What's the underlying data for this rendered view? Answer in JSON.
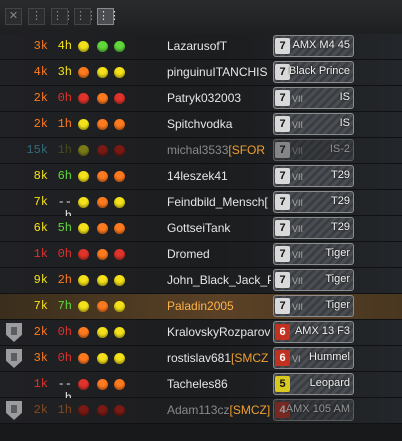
{
  "toolbar": {
    "buttons": [
      {
        "icon": "close-icon",
        "glyph": "✕"
      },
      {
        "icon": "column-toggle-1-icon",
        "glyph": "⋮"
      },
      {
        "icon": "column-toggle-2-icon",
        "glyph": "⋮⋮"
      },
      {
        "icon": "column-toggle-3-icon",
        "glyph": "⋮⋮"
      },
      {
        "icon": "column-toggle-4-icon",
        "glyph": "⋮⋮"
      }
    ]
  },
  "colors": {
    "red": "#e0332b",
    "orange": "#ff7a1f",
    "yellow": "#f4e11a",
    "green": "#60d83a",
    "cyan": "#4cc3e0",
    "white": "#e8e8e8",
    "darkred": "#7a1a14",
    "olive": "#7a7a1a",
    "grey": "#6a6a6a"
  },
  "players": [
    {
      "wins": "3k",
      "wc": "orange",
      "time": "4h",
      "tc": "yellow",
      "d": [
        "yellow",
        "green",
        "green"
      ],
      "name": "LazarusofT",
      "clan": "",
      "tier": "7",
      "tc2": "white",
      "roman": "",
      "tank": "AMX M4 45",
      "badge": false,
      "self": false,
      "dead": false
    },
    {
      "wins": "4k",
      "wc": "orange",
      "time": "3h",
      "tc": "yellow",
      "d": [
        "orange",
        "yellow",
        "yellow"
      ],
      "name": "pinguinuITANCHIS",
      "clan": "",
      "tier": "7",
      "tc2": "white",
      "roman": "",
      "tank": "Black Prince",
      "badge": false,
      "self": false,
      "dead": false
    },
    {
      "wins": "2k",
      "wc": "orange",
      "time": "0h",
      "tc": "red",
      "d": [
        "red",
        "orange",
        "red"
      ],
      "name": "Patryk032003",
      "clan": "",
      "tier": "7",
      "tc2": "white",
      "roman": "VII",
      "tank": "IS",
      "badge": false,
      "self": false,
      "dead": false
    },
    {
      "wins": "2k",
      "wc": "orange",
      "time": "1h",
      "tc": "orange",
      "d": [
        "yellow",
        "orange",
        "orange"
      ],
      "name": "Spitchvodka",
      "clan": "",
      "tier": "7",
      "tc2": "white",
      "roman": "VII",
      "tank": "IS",
      "badge": false,
      "self": false,
      "dead": false
    },
    {
      "wins": "15k",
      "wc": "cyan",
      "time": "1h",
      "tc": "olive",
      "d": [
        "olive",
        "darkred",
        "darkred"
      ],
      "name": "michal3533",
      "clan": "[SFOR",
      "tier": "7",
      "tc2": "white",
      "roman": "VII",
      "tank": "IS-2",
      "badge": false,
      "self": false,
      "dead": true
    },
    {
      "wins": "8k",
      "wc": "yellow",
      "time": "6h",
      "tc": "green",
      "d": [
        "yellow",
        "orange",
        "orange"
      ],
      "name": "14leszek41",
      "clan": "",
      "tier": "7",
      "tc2": "white",
      "roman": "VII",
      "tank": "T29",
      "badge": false,
      "self": false,
      "dead": false
    },
    {
      "wins": "7k",
      "wc": "yellow",
      "time": "--h",
      "tc": "white",
      "d": [
        "yellow",
        "orange",
        "yellow"
      ],
      "name": "Feindbild_Mensch[",
      "clan": "",
      "tier": "7",
      "tc2": "white",
      "roman": "VII",
      "tank": "T29",
      "badge": false,
      "self": false,
      "dead": false
    },
    {
      "wins": "6k",
      "wc": "yellow",
      "time": "5h",
      "tc": "green",
      "d": [
        "yellow",
        "orange",
        "orange"
      ],
      "name": "GottseiTank",
      "clan": "",
      "tier": "7",
      "tc2": "white",
      "roman": "VII",
      "tank": "T29",
      "badge": false,
      "self": false,
      "dead": false
    },
    {
      "wins": "1k",
      "wc": "red",
      "time": "0h",
      "tc": "red",
      "d": [
        "red",
        "orange",
        "red"
      ],
      "name": "Dromed",
      "clan": "",
      "tier": "7",
      "tc2": "white",
      "roman": "VII",
      "tank": "Tiger",
      "badge": false,
      "self": false,
      "dead": false
    },
    {
      "wins": "9k",
      "wc": "yellow",
      "time": "2h",
      "tc": "orange",
      "d": [
        "yellow",
        "yellow",
        "yellow"
      ],
      "name": "John_Black_Jack_P",
      "clan": "",
      "tier": "7",
      "tc2": "white",
      "roman": "VII",
      "tank": "Tiger",
      "badge": false,
      "self": false,
      "dead": false
    },
    {
      "wins": "7k",
      "wc": "yellow",
      "time": "7h",
      "tc": "green",
      "d": [
        "yellow",
        "orange",
        "yellow"
      ],
      "name": "Paladin2005",
      "clan": "",
      "tier": "7",
      "tc2": "white",
      "roman": "VII",
      "tank": "Tiger",
      "badge": false,
      "self": true,
      "dead": false
    },
    {
      "wins": "2k",
      "wc": "orange",
      "time": "0h",
      "tc": "red",
      "d": [
        "orange",
        "yellow",
        "yellow"
      ],
      "name": "KralovskyRozparov",
      "clan": "",
      "tier": "6",
      "tc2": "red",
      "roman": "",
      "tank": "AMX 13 F3",
      "badge": true,
      "self": false,
      "dead": false
    },
    {
      "wins": "3k",
      "wc": "orange",
      "time": "0h",
      "tc": "red",
      "d": [
        "orange",
        "yellow",
        "yellow"
      ],
      "name": "rostislav681",
      "clan": "[SMCZ",
      "tier": "6",
      "tc2": "red",
      "roman": "VI",
      "tank": "Hummel",
      "badge": true,
      "self": false,
      "dead": false
    },
    {
      "wins": "1k",
      "wc": "red",
      "time": "--h",
      "tc": "white",
      "d": [
        "red",
        "orange",
        "orange"
      ],
      "name": "Tacheles86",
      "clan": "",
      "tier": "5",
      "tc2": "yellow",
      "roman": "",
      "tank": "Leopard",
      "badge": false,
      "self": false,
      "dead": false
    },
    {
      "wins": "2k",
      "wc": "orange",
      "time": "1h",
      "tc": "orange",
      "d": [
        "darkred",
        "darkred",
        "darkred"
      ],
      "name": "Adam113cz",
      "clan": "[SMCZ]",
      "tier": "4",
      "tc2": "red",
      "roman": "",
      "tank": "AMX 105 AM",
      "badge": true,
      "self": false,
      "dead": true
    }
  ]
}
